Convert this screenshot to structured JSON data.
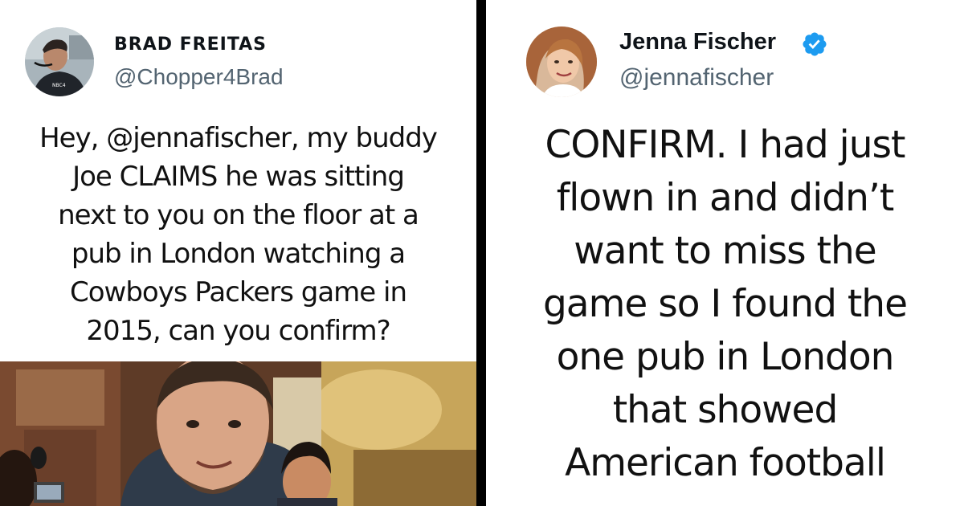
{
  "left_tweet": {
    "author_name": "BRAD FREITAS",
    "author_handle": "@Chopper4Brad",
    "text": "Hey, @jennafischer, my buddy\nJoe CLAIMS he was sitting\nnext to you on the floor at a\npub in London watching a\nCowboys Packers game in\n2015, can you confirm?"
  },
  "right_tweet": {
    "author_name": "Jenna Fischer",
    "author_handle": "@jennafischer",
    "verified_icon": "verified-badge-icon",
    "text": "CONFIRM. I had just\nflown in and didn’t\nwant to miss the\ngame so I found the\none pub in London\nthat showed\nAmerican football"
  },
  "colors": {
    "name_text": "#0f1419",
    "handle_text": "#536471",
    "verified_blue": "#1d9bf0",
    "divider": "#000000"
  }
}
